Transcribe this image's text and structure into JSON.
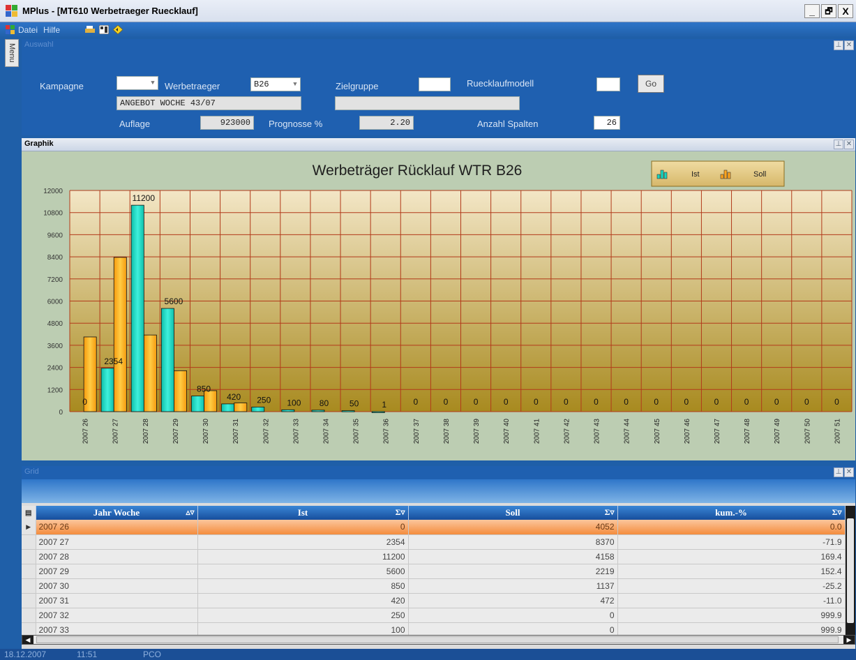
{
  "window": {
    "title": "MPlus - [MT610 Werbetraeger Ruecklauf]",
    "controls": [
      "_",
      "🗗",
      "X"
    ]
  },
  "menu": {
    "items": [
      {
        "label": "Datei"
      },
      {
        "label": "Hilfe"
      }
    ],
    "side_tab": "Menu"
  },
  "auswahl": {
    "title": "Auswahl",
    "kampagne_label": "Kampagne",
    "kampagne_value": "",
    "werbetraeger_label": "Werbetraeger",
    "werbetraeger_value": "B26",
    "werbetraeger_desc": "ANGEBOT WOCHE 43/07",
    "zielgruppe_label": "Zielgruppe",
    "zielgruppe_value": "",
    "zielgruppe_desc": "",
    "ruecklaufmodell_label": "Ruecklaufmodell",
    "ruecklaufmodell_value": "",
    "go_label": "Go",
    "auflage_label": "Auflage",
    "auflage_value": "923000",
    "prognosse_label": "Prognosse %",
    "prognosse_value": "2.20",
    "anzahl_label": "Anzahl Spalten",
    "anzahl_value": "26"
  },
  "graphik": {
    "title": "Graphik"
  },
  "chart_data": {
    "type": "bar",
    "title": "Werbeträger Rücklauf WTR B26",
    "xlabel": "",
    "ylabel": "",
    "ylim": [
      0,
      12000
    ],
    "yticks": [
      0,
      1200,
      2400,
      3600,
      4800,
      6000,
      7200,
      8400,
      9600,
      10800,
      12000
    ],
    "legend_position": "top-right",
    "grid": true,
    "categories": [
      "2007 26",
      "2007 27",
      "2007 28",
      "2007 29",
      "2007 30",
      "2007 31",
      "2007 32",
      "2007 33",
      "2007 34",
      "2007 35",
      "2007 36",
      "2007 37",
      "2007 38",
      "2007 39",
      "2007 40",
      "2007 41",
      "2007 42",
      "2007 43",
      "2007 44",
      "2007 45",
      "2007 46",
      "2007 47",
      "2007 48",
      "2007 49",
      "2007 50",
      "2007 51"
    ],
    "series": [
      {
        "name": "Ist",
        "color": "#19d6c0",
        "values": [
          0,
          2354,
          11200,
          5600,
          850,
          420,
          250,
          100,
          80,
          50,
          1,
          0,
          0,
          0,
          0,
          0,
          0,
          0,
          0,
          0,
          0,
          0,
          0,
          0,
          0,
          0
        ]
      },
      {
        "name": "Soll",
        "color": "#ffa51f",
        "values": [
          4052,
          8370,
          4158,
          2219,
          1137,
          472,
          0,
          0,
          0,
          0,
          0,
          0,
          0,
          0,
          0,
          0,
          0,
          0,
          0,
          0,
          0,
          0,
          0,
          0,
          0,
          0
        ]
      }
    ],
    "data_labels": [
      "0",
      "2354",
      "11200",
      "5600",
      "850",
      "420",
      "250",
      "100",
      "80",
      "50",
      "1",
      "0",
      "0",
      "0",
      "0",
      "0",
      "0",
      "0",
      "0",
      "0",
      "0",
      "0",
      "0",
      "0",
      "0",
      "0"
    ]
  },
  "grid": {
    "title": "Grid",
    "columns": [
      {
        "label": "Jahr Woche",
        "symbol": "▵▿"
      },
      {
        "label": "Ist",
        "symbol": "Σ▿"
      },
      {
        "label": "Soll",
        "symbol": "Σ▿"
      },
      {
        "label": "kum.-%",
        "symbol": "Σ▿"
      }
    ],
    "rows": [
      [
        "2007 26",
        "0",
        "4052",
        "0.0"
      ],
      [
        "2007 27",
        "2354",
        "8370",
        "-71.9"
      ],
      [
        "2007 28",
        "11200",
        "4158",
        "169.4"
      ],
      [
        "2007 29",
        "5600",
        "2219",
        "152.4"
      ],
      [
        "2007 30",
        "850",
        "1137",
        "-25.2"
      ],
      [
        "2007 31",
        "420",
        "472",
        "-11.0"
      ],
      [
        "2007 32",
        "250",
        "0",
        "999.9"
      ],
      [
        "2007 33",
        "100",
        "0",
        "999.9"
      ]
    ],
    "selected_row": 0
  },
  "status": {
    "date": "18.12.2007",
    "time": "11:51",
    "user": "PCO"
  }
}
